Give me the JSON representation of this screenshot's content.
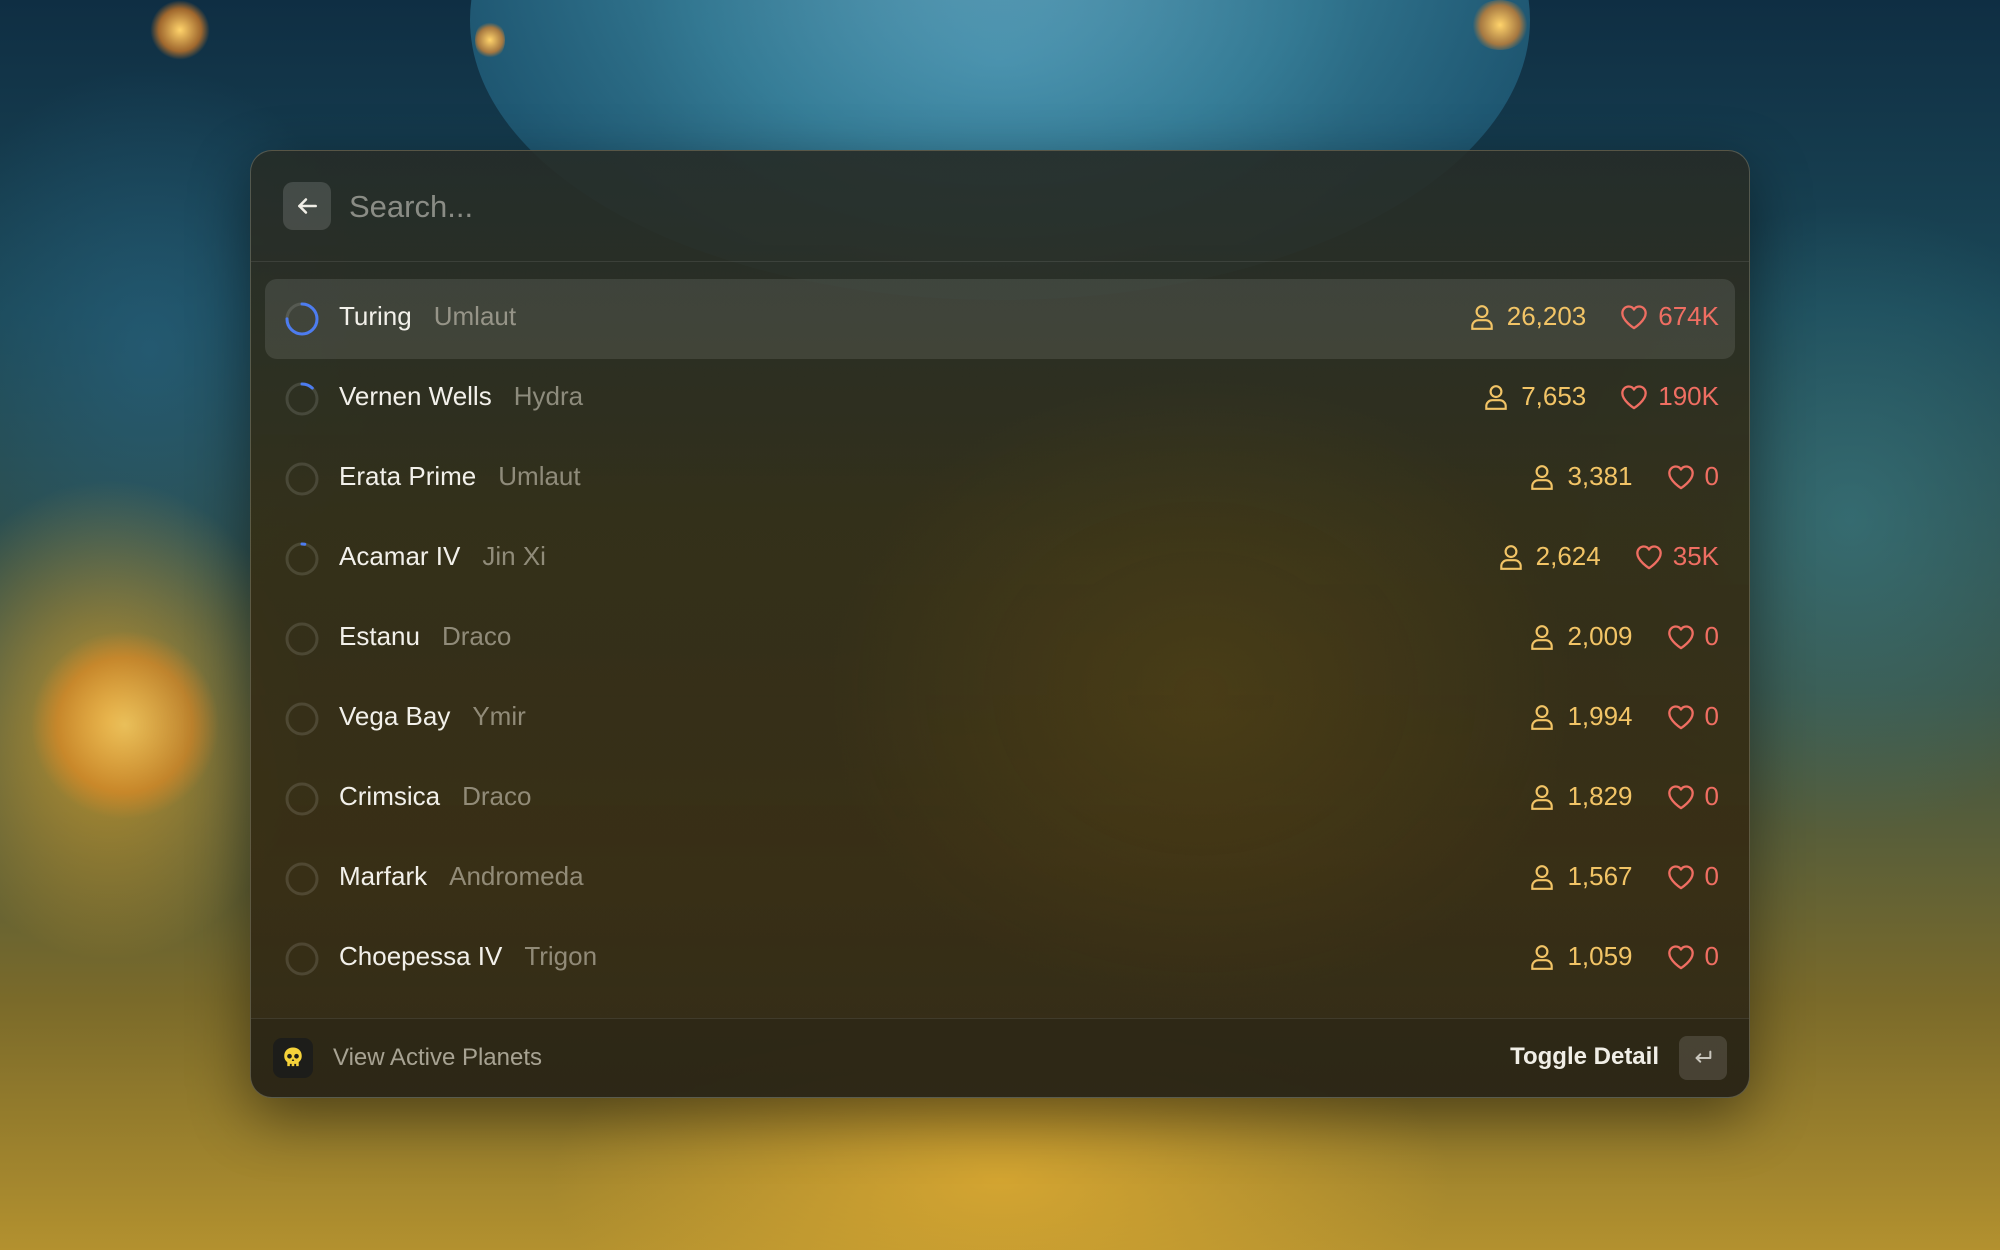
{
  "search": {
    "placeholder": "Search...",
    "value": ""
  },
  "planets": [
    {
      "name": "Turing",
      "sector": "Umlaut",
      "players": "26,203",
      "health": "674K",
      "liberation": 0.75,
      "selected": true
    },
    {
      "name": "Vernen Wells",
      "sector": "Hydra",
      "players": "7,653",
      "health": "190K",
      "liberation": 0.12
    },
    {
      "name": "Erata Prime",
      "sector": "Umlaut",
      "players": "3,381",
      "health": "0",
      "liberation": 0
    },
    {
      "name": "Acamar IV",
      "sector": "Jin Xi",
      "players": "2,624",
      "health": "35K",
      "liberation": 0.03
    },
    {
      "name": "Estanu",
      "sector": "Draco",
      "players": "2,009",
      "health": "0",
      "liberation": 0
    },
    {
      "name": "Vega Bay",
      "sector": "Ymir",
      "players": "1,994",
      "health": "0",
      "liberation": 0
    },
    {
      "name": "Crimsica",
      "sector": "Draco",
      "players": "1,829",
      "health": "0",
      "liberation": 0
    },
    {
      "name": "Marfark",
      "sector": "Andromeda",
      "players": "1,567",
      "health": "0",
      "liberation": 0
    },
    {
      "name": "Choepessa IV",
      "sector": "Trigon",
      "players": "1,059",
      "health": "0",
      "liberation": 0
    }
  ],
  "footer": {
    "command_label": "View Active Planets",
    "action_label": "Toggle Detail",
    "app_icon": "helldivers-skull-icon",
    "action_key_icon": "return-key-icon"
  },
  "colors": {
    "players": "#f2c466",
    "health": "#ef6e62",
    "progress": "#4d7cf0"
  }
}
